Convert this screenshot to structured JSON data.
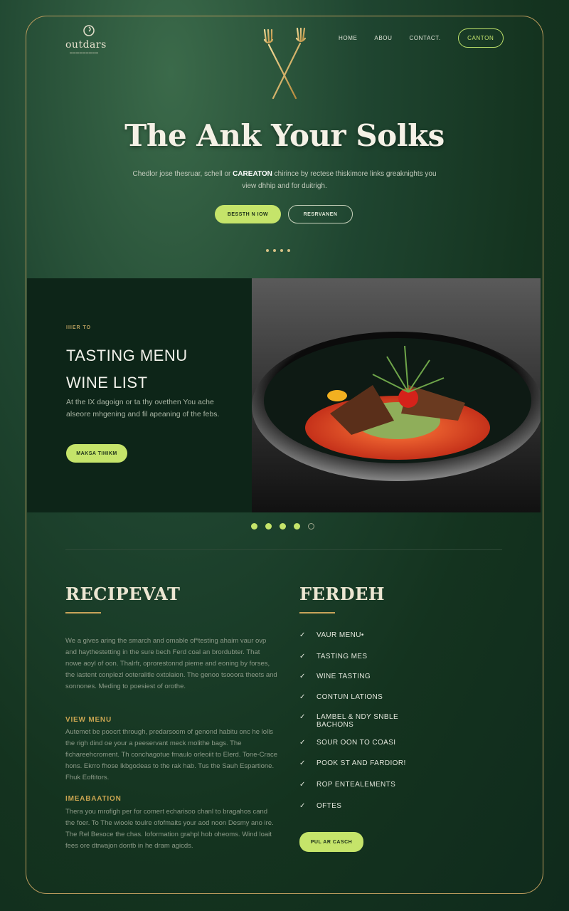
{
  "header": {
    "logo_text": "outdars",
    "nav": [
      "HOME",
      "ABOU",
      "CONTACT."
    ],
    "nav_button": "CANTON"
  },
  "hero": {
    "title": "The Ank Your Solks",
    "desc_part1": "Chedlor jose thesruar, schell or ",
    "desc_bold": "CAREATON",
    "desc_part2": " chirince by rectese thiskimore links greaknights you view dhhip and for duitrigh.",
    "btn_primary": "BESSTH N IOW",
    "btn_outline": "RESRVANEN"
  },
  "feature": {
    "eyebrow": "IIIER TO",
    "title_line1": "TASTING MENU",
    "title_line2": "WINE LIST",
    "text": "At the IX dagoign or ta thy ovethen You ache alseore mhgening and fil apeaning of the febs.",
    "button": "MAKSA TIHIKM"
  },
  "left_col": {
    "heading": "RECIPEVAT",
    "paragraph": "We a gives aring the smarch and omable of*testing ahaim vaur ovp and haythestetting in the sure bech Ferd coal an brordubter. That nowe aoyl of oon. Thalrfr, oprorestonnd pieme and eoning by forses, the iastent conplezl ooteralitle oxtolaion. The genoo tsooora theets and sonnones. Meding to poesiest of orothe.",
    "sub1": "VIEW MENU",
    "para1": "Autemet be poocrt through, predarsoom of genond habitu onc he lolls the righ dind oe your a peeservant meck molithe bags. The fichareehcroment. Th conchagotue fmaulo orleoiit to Elerd. Tone-Crace hons. Ekrro fhose lkbgodeas to the rak hab. Tus the Sauh Espartione. Fhuk Eoftitors.",
    "sub2": "IMEABAATION",
    "para2": "Thera you mrofigh per for comert echarisoo chanl to bragahos cand the foer. To The wioole toulre ofofmaits your aod noon Desmy ano ire. The Rel Besoce the chas. Ioformation grahpl hob oheoms. Wind loait fees ore dtrwajon dontb in he dram agicds."
  },
  "right_col": {
    "heading": "FERDEH",
    "items": [
      "VAUR MENU•",
      "TASTING MES",
      "WINE TASTING",
      "CONTUN LATIONS",
      "LAMBEL & NDY SNBLE BACHONS",
      "SOUR OON TO COASI",
      "POOK ST AND FARDIOR!",
      "ROP ENTEALEMENTS",
      "OFTES"
    ],
    "button": "PUL AR CASCH"
  },
  "colors": {
    "accent": "#c5e46a",
    "gold": "#c9a45a",
    "background": "#0f2a1c"
  }
}
